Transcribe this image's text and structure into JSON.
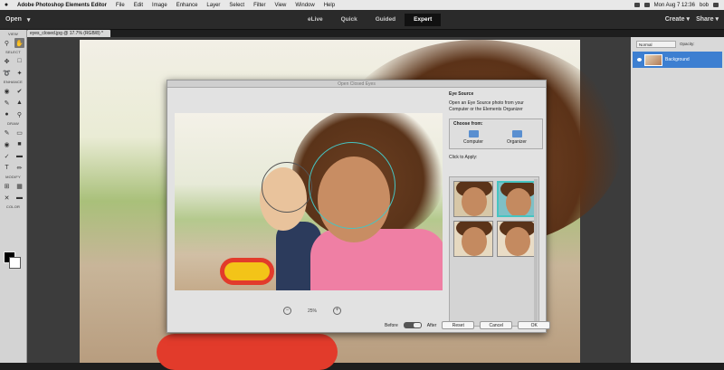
{
  "menubar": {
    "apple": "",
    "items": [
      "Adobe Photoshop Elements Editor",
      "File",
      "Edit",
      "Image",
      "Enhance",
      "Layer",
      "Select",
      "Filter",
      "View",
      "Window",
      "Help"
    ],
    "clock": "Mon Aug 7  12:36",
    "user": "bob"
  },
  "topbar": {
    "open": "Open",
    "modes": [
      "eLive",
      "Quick",
      "Guided",
      "Expert"
    ],
    "active_mode": "Expert",
    "create": "Create",
    "share": "Share"
  },
  "document_tab": "eyes_closed.jpg @ 17.7% (RGB/8) *",
  "toolbox": {
    "sections": [
      "VIEW",
      "SELECT",
      "ENHANCE",
      "DRAW",
      "MODIFY",
      "COLOR"
    ]
  },
  "layers_panel": {
    "blend_mode": "Normal",
    "opacity_label": "Opacity:",
    "layer_name": "Background"
  },
  "dialog": {
    "title": "Open Closed Eyes",
    "eye_source_heading": "Eye Source",
    "eye_source_text": "Open an Eye Source photo from your Computer or the Elements Organizer",
    "choose_from": "Choose from:",
    "computer": "Computer",
    "organizer": "Organizer",
    "click_to_apply": "Click to Apply:",
    "zoom_value": "25%",
    "before": "Before",
    "after": "After",
    "reset": "Reset",
    "cancel": "Cancel",
    "ok": "OK"
  },
  "colors": {
    "accent": "#46c4c2",
    "layer_selected": "#3d7fd1"
  }
}
